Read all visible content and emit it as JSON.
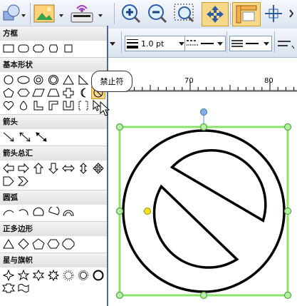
{
  "toolbar_2": {
    "line_width": "1.0 pt"
  },
  "ruler": {
    "marks": [
      "70",
      "80"
    ]
  },
  "shape_panel": {
    "sections": [
      {
        "title": "方框"
      },
      {
        "title": "基本形状"
      },
      {
        "title": "箭头"
      },
      {
        "title": "箭头总汇"
      },
      {
        "title": "圆弧"
      },
      {
        "title": "正多边形"
      },
      {
        "title": "星与旗帜"
      }
    ]
  },
  "tooltip": {
    "text": "禁止符"
  },
  "colors": {
    "toolbar_bg": "#dbe4f1",
    "panel_border": "#4a6a9a",
    "selection_green": "#8be36a",
    "handle_fill": "#b6f0a6",
    "rotate_handle": "#7fb3e6",
    "adjust_handle": "#f0e020",
    "shape_stroke": "#000000"
  }
}
